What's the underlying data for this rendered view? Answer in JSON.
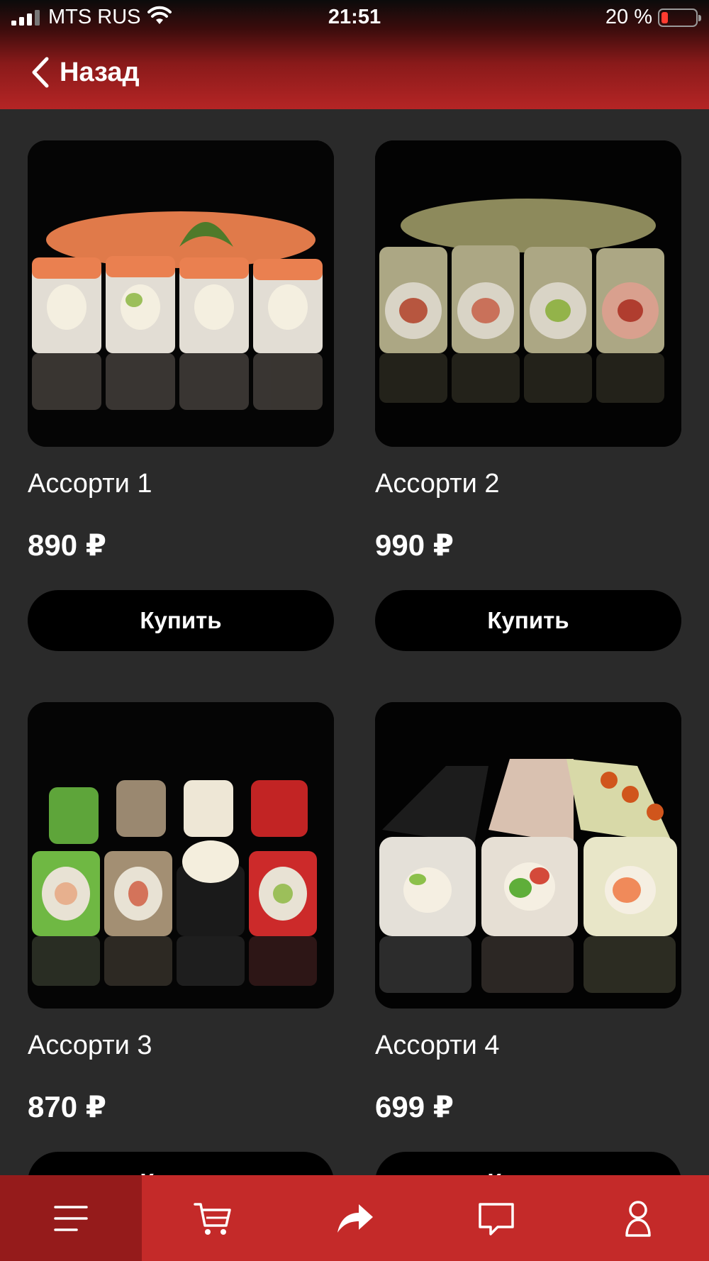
{
  "status_bar": {
    "carrier": "MTS RUS",
    "time": "21:51",
    "battery": "20 %",
    "battery_level": 0.2
  },
  "header": {
    "back_label": "Назад"
  },
  "products": [
    {
      "name": "Ассорти 1",
      "price": "890 ₽",
      "buy_label": "Купить"
    },
    {
      "name": "Ассорти 2",
      "price": "990 ₽",
      "buy_label": "Купить"
    },
    {
      "name": "Ассорти 3",
      "price": "870 ₽",
      "buy_label": "Купить"
    },
    {
      "name": "Ассорти 4",
      "price": "699 ₽",
      "buy_label": "Купить"
    }
  ],
  "tabbar": {
    "items": [
      "menu-icon",
      "cart-icon",
      "share-icon",
      "chat-icon",
      "profile-icon"
    ],
    "active": "menu-icon"
  },
  "colors": {
    "accent": "#c42a29",
    "accent_dark": "#951b1b",
    "background": "#2a2a2a"
  }
}
